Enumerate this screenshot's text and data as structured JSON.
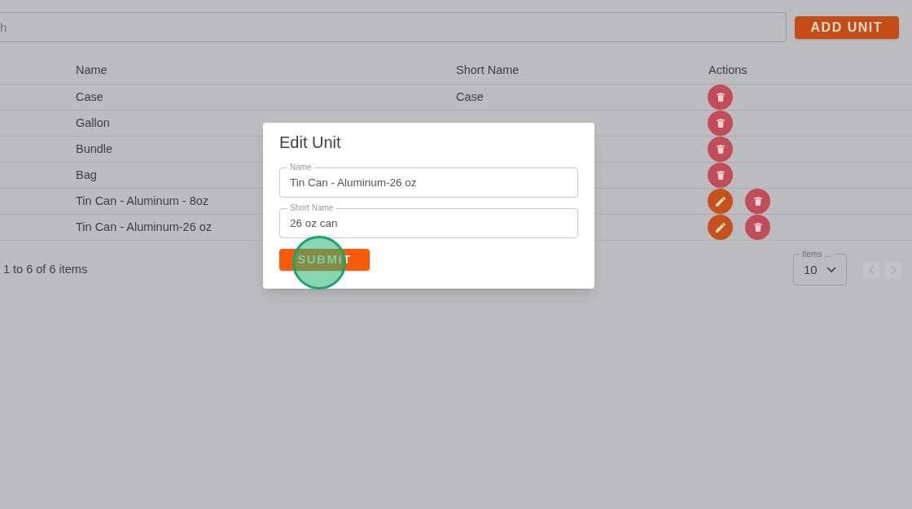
{
  "search": {
    "placeholder": "h"
  },
  "add_button": "ADD UNIT",
  "table": {
    "columns": [
      "Name",
      "Short Name",
      "Actions"
    ],
    "rows": [
      {
        "name": "Case",
        "short_name": "Case",
        "actions": [
          {
            "kind": "delete"
          }
        ]
      },
      {
        "name": "Gallon",
        "actions": [
          {
            "kind": "delete"
          }
        ]
      },
      {
        "name": "Bundle",
        "actions": [
          {
            "kind": "delete"
          }
        ]
      },
      {
        "name": "Bag",
        "actions": [
          {
            "kind": "delete"
          }
        ]
      },
      {
        "name": "Tin Can - Aluminum - 8oz",
        "actions": [
          {
            "kind": "edit"
          },
          {
            "kind": "delete"
          }
        ]
      },
      {
        "name": "Tin Can - Aluminum-26 oz",
        "actions": [
          {
            "kind": "edit"
          },
          {
            "kind": "delete"
          }
        ]
      }
    ]
  },
  "pagination": {
    "summary": "1 to 6 of 6 items",
    "page_size_label": "Items ...",
    "page_size": "10",
    "prev_disabled": true,
    "next_disabled": true
  },
  "dialog": {
    "title": "Edit Unit",
    "fields": [
      {
        "label": "Name",
        "value": "Tin Can - Aluminum-26 oz"
      },
      {
        "label": "Short Name",
        "value": "26 oz can"
      }
    ],
    "submit": "SUBMIT",
    "click_marker": true
  }
}
